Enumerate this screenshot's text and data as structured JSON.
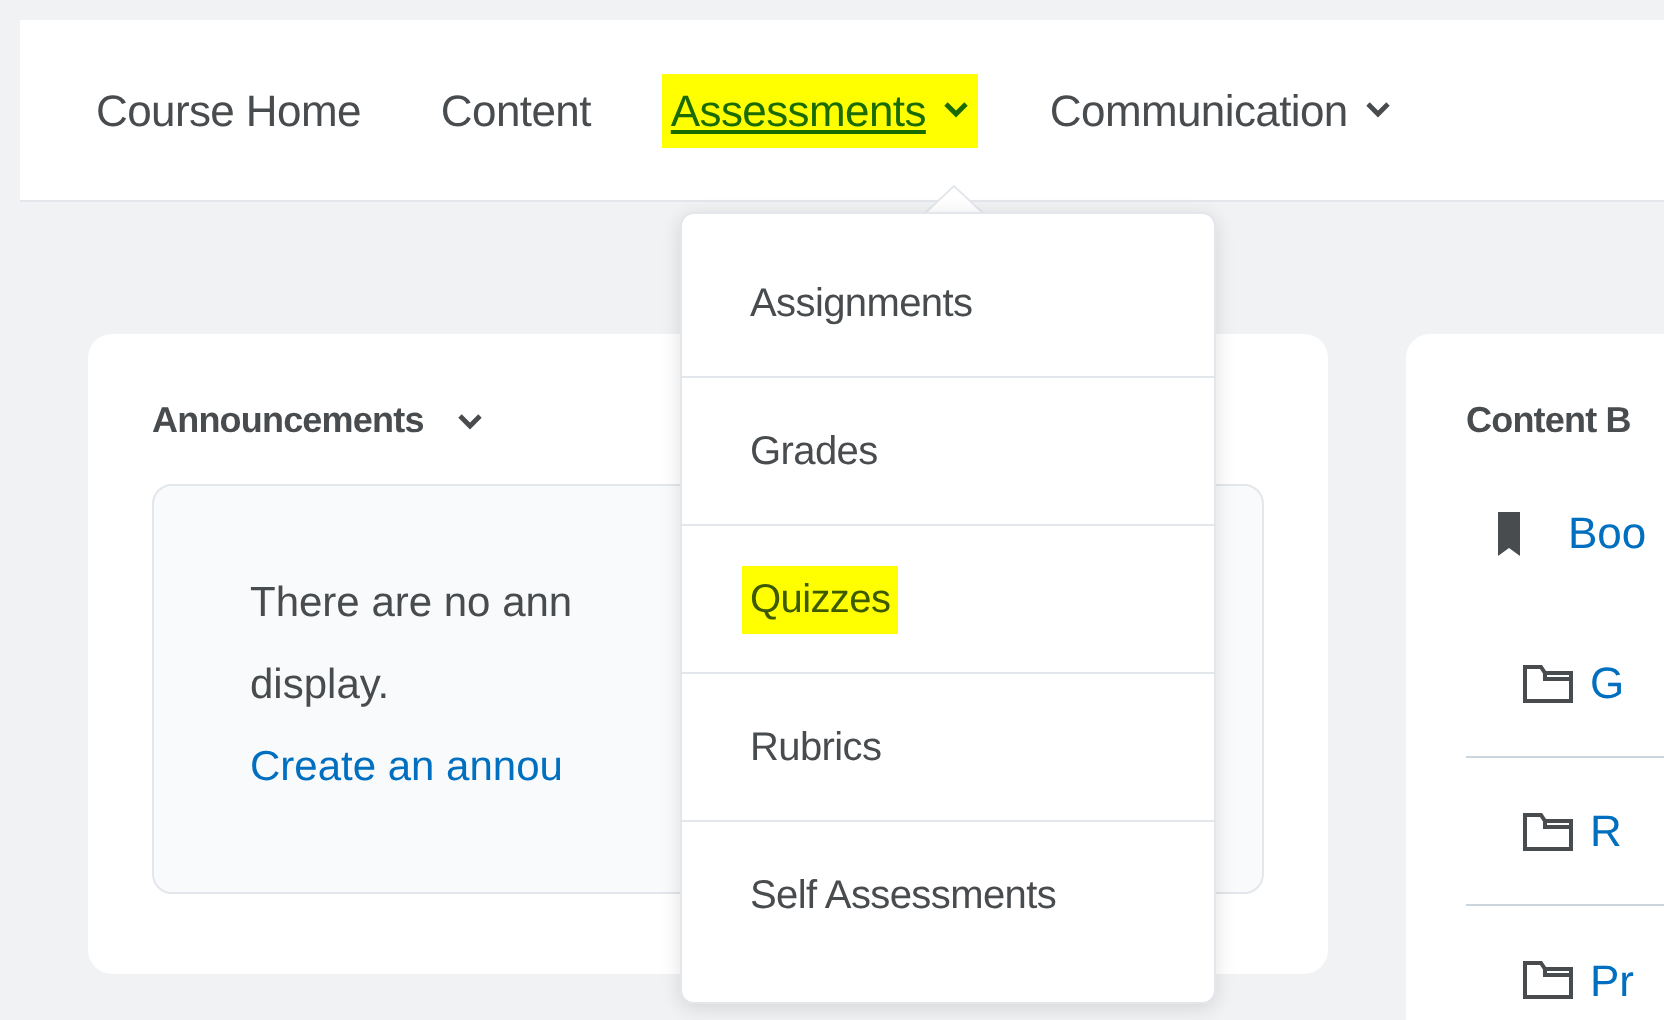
{
  "nav": {
    "items": [
      {
        "label": "Course Home",
        "dropdown": false,
        "highlighted": false
      },
      {
        "label": "Content",
        "dropdown": false,
        "highlighted": false
      },
      {
        "label": "Assessments",
        "dropdown": true,
        "highlighted": true
      },
      {
        "label": "Communication",
        "dropdown": true,
        "highlighted": false
      }
    ]
  },
  "dropdown_menu": {
    "items": [
      {
        "label": "Assignments",
        "highlighted": false
      },
      {
        "label": "Grades",
        "highlighted": false
      },
      {
        "label": "Quizzes",
        "highlighted": true
      },
      {
        "label": "Rubrics",
        "highlighted": false
      },
      {
        "label": "Self Assessments",
        "highlighted": false
      }
    ]
  },
  "announcements": {
    "title": "Announcements",
    "message_lines": [
      "There are no ann",
      "display."
    ],
    "link": "Create an annou"
  },
  "content_browser": {
    "title": "Content B",
    "bookmark_link": "Boo",
    "folders": [
      "G",
      "R",
      "Pr"
    ]
  }
}
